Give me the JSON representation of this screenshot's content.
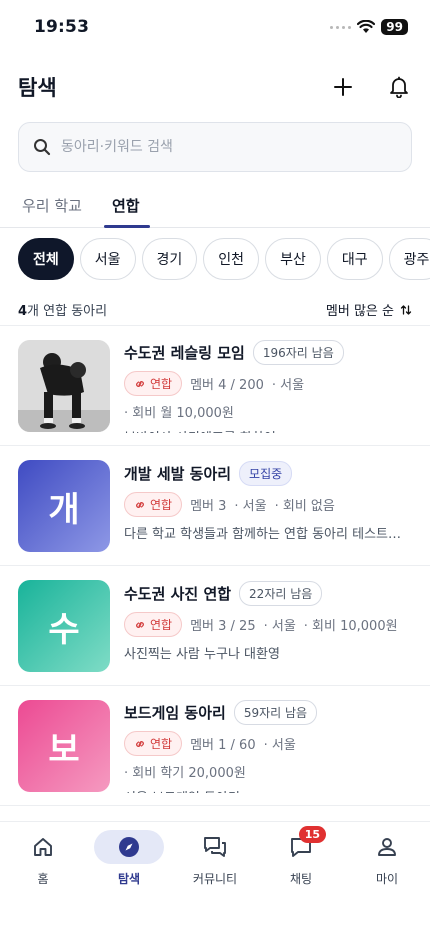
{
  "status_bar": {
    "time": "19:53",
    "battery": "99"
  },
  "header": {
    "title": "탐색"
  },
  "search": {
    "placeholder": "동아리·키워드 검색"
  },
  "tabs": [
    {
      "label": "우리 학교"
    },
    {
      "label": "연합"
    }
  ],
  "chips": [
    {
      "label": "전체"
    },
    {
      "label": "서울"
    },
    {
      "label": "경기"
    },
    {
      "label": "인천"
    },
    {
      "label": "부산"
    },
    {
      "label": "대구"
    },
    {
      "label": "광주"
    }
  ],
  "list_meta": {
    "count": "4",
    "count_suffix": "개 연합 동아리",
    "sort_label": "멤버 많은 순"
  },
  "clubs": [
    {
      "name": "수도권 레슬링 모임",
      "badge": "196자리 남음",
      "tag": "연합",
      "members": "멤버 4 / 200",
      "region": "· 서울",
      "fee": "· 회비 월 10,000원",
      "desc": "부바이사 사티에프를 향하여.."
    },
    {
      "name": "개발 세발 동아리",
      "badge": "모집중",
      "thumb_letter": "개",
      "thumb_color_start": "#3f4bc2",
      "thumb_color_end": "#8e98e6",
      "tag": "연합",
      "members": "멤버 3",
      "region": "· 서울",
      "fee": "· 회비 없음",
      "desc": "다른 학교 학생들과 함께하는 연합 동아리 테스트용..."
    },
    {
      "name": "수도권 사진 연합",
      "badge": "22자리 남음",
      "thumb_letter": "수",
      "thumb_color_start": "#19b39a",
      "thumb_color_end": "#7fdcc6",
      "tag": "연합",
      "members": "멤버 3 / 25",
      "region": "· 서울",
      "fee": "· 회비 10,000원",
      "desc": "사진찍는 사람 누구나 대환영"
    },
    {
      "name": "보드게임 동아리",
      "badge": "59자리 남음",
      "thumb_letter": "보",
      "thumb_color_start": "#ec4a93",
      "thumb_color_end": "#f59ac0",
      "tag": "연합",
      "members": "멤버 1 / 60",
      "region": "· 서울",
      "fee": "· 회비 학기 20,000원",
      "desc": "서울 보드게임 동아리"
    }
  ],
  "bottom_nav": [
    {
      "label": "홈",
      "icon": "home-icon"
    },
    {
      "label": "탐색",
      "icon": "compass-icon"
    },
    {
      "label": "커뮤니티",
      "icon": "community-icon"
    },
    {
      "label": "채팅",
      "icon": "chat-icon",
      "badge": "15"
    },
    {
      "label": "마이",
      "icon": "person-icon"
    }
  ],
  "colors": {
    "accent": "#2f3a8f",
    "union_red": "#d23b3b",
    "chip_active": "#0f172a"
  }
}
